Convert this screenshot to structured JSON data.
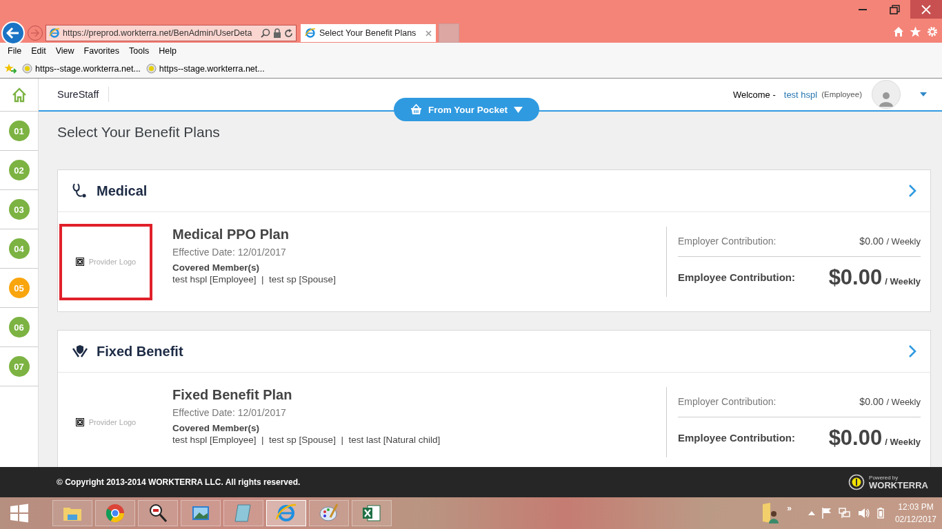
{
  "browser": {
    "address": "https://preprod.workterra.net/BenAdmin/UserDeta",
    "tab": {
      "title": "Select Your Benefit Plans",
      "selected": true
    },
    "menu": [
      "File",
      "Edit",
      "View",
      "Favorites",
      "Tools",
      "Help"
    ],
    "favorites": [
      "https--stage.workterra.net...",
      "https--stage.workterra.net..."
    ]
  },
  "header": {
    "company": "SureStaff",
    "pocket_button": "From Your Pocket",
    "welcome": "Welcome -",
    "user": "test hspl",
    "role": "(Employee)"
  },
  "steps": [
    {
      "label": "01",
      "selected": false
    },
    {
      "label": "02",
      "selected": false
    },
    {
      "label": "03",
      "selected": false
    },
    {
      "label": "04",
      "selected": false
    },
    {
      "label": "05",
      "selected": true
    },
    {
      "label": "06",
      "selected": false
    },
    {
      "label": "07",
      "selected": false
    }
  ],
  "page_title": "Select Your Benefit Plans",
  "benefits": [
    {
      "kind": "medical",
      "category": "Medical",
      "logo_text": "Provider Logo",
      "logo_highlighted": true,
      "plan": "Medical PPO Plan",
      "effective": "Effective Date: 12/01/2017",
      "members_label": "Covered Member(s)",
      "members": "test hspl [Employee]  |  test sp [Spouse]",
      "employer_label": "Employer Contribution:",
      "employer_amount": "$0.00",
      "employer_period": "/ Weekly",
      "employee_label": "Employee Contribution:",
      "employee_amount": "$0.00",
      "employee_period": "/ Weekly"
    },
    {
      "kind": "fixed",
      "category": "Fixed Benefit",
      "logo_text": "Provider Logo",
      "logo_highlighted": false,
      "plan": "Fixed Benefit Plan",
      "effective": "Effective Date: 12/01/2017",
      "members_label": "Covered Member(s)",
      "members": "test hspl [Employee]  |  test sp [Spouse]  |  test last [Natural child]",
      "employer_label": "Employer Contribution:",
      "employer_amount": "$0.00",
      "employer_period": "/ Weekly",
      "employee_label": "Employee Contribution:",
      "employee_amount": "$0.00",
      "employee_period": "/ Weekly"
    }
  ],
  "footer": {
    "copyright": "© Copyright 2013-2014 WORKTERRA LLC. All rights reserved.",
    "powered_by": "Powered by",
    "brand": "WORKTERRA"
  },
  "taskbar": {
    "apps": [
      {
        "kind": "folder",
        "selected": false
      },
      {
        "kind": "chrome",
        "selected": false
      },
      {
        "kind": "magnifier",
        "selected": false
      },
      {
        "kind": "photos",
        "selected": false
      },
      {
        "kind": "notepad",
        "selected": false
      },
      {
        "kind": "ie",
        "selected": true
      },
      {
        "kind": "paint",
        "selected": false
      },
      {
        "kind": "excel",
        "selected": false
      }
    ],
    "overflow": "»",
    "time": "12:03 PM",
    "date": "02/12/2017"
  }
}
